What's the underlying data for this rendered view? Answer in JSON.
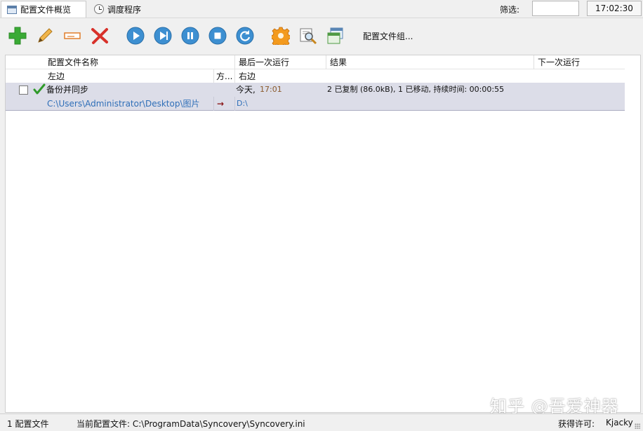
{
  "tabs": [
    {
      "label": "配置文件概览",
      "icon": "document-icon",
      "active": true
    },
    {
      "label": "调度程序",
      "icon": "clock-icon",
      "active": false
    }
  ],
  "filter": {
    "label": "筛选:",
    "value": ""
  },
  "clock": "17:02:30",
  "toolbar": {
    "buttons": [
      {
        "name": "add-profile-button",
        "icon": "plus-icon"
      },
      {
        "name": "edit-profile-button",
        "icon": "pencil-icon"
      },
      {
        "name": "rename-profile-button",
        "icon": "rename-icon"
      },
      {
        "name": "delete-profile-button",
        "icon": "x-icon"
      },
      {
        "name": "run-button",
        "icon": "play-icon"
      },
      {
        "name": "run-attended-button",
        "icon": "play-next-icon"
      },
      {
        "name": "pause-button",
        "icon": "pause-icon"
      },
      {
        "name": "stop-button",
        "icon": "stop-icon"
      },
      {
        "name": "refresh-button",
        "icon": "refresh-icon"
      },
      {
        "name": "settings-button",
        "icon": "gear-icon"
      },
      {
        "name": "log-button",
        "icon": "search-log-icon"
      },
      {
        "name": "profile-groups-button",
        "icon": "window-icon"
      }
    ],
    "groups_label": "配置文件组..."
  },
  "grid": {
    "headers_row1": {
      "name": "配置文件名称",
      "last_run": "最后一次运行",
      "result": "结果",
      "next_run": "下一次运行"
    },
    "headers_row2": {
      "left": "左边",
      "direction": "方...",
      "right": "右边"
    },
    "profiles": [
      {
        "name": "备份并同步",
        "last_run_day": "今天,",
        "last_run_time": "17:01",
        "result": "2 已复制 (86.0kB), 1 已移动, 持续时间: 00:00:55",
        "next_run": "",
        "left_path": "C:\\Users\\Administrator\\Desktop\\图片",
        "direction": "→",
        "right_path": "D:\\"
      }
    ]
  },
  "status": {
    "count": "1 配置文件",
    "current_label": "当前配置文件: C:\\ProgramData\\Syncovery\\Syncovery.ini",
    "license_label": "获得许可:",
    "license_user": "Kjacky"
  },
  "watermark": "知乎 @吾爱神器",
  "colors": {
    "selected_row": "#dcdde8",
    "path_text": "#2f6fb8",
    "accent_blue": "#3d8fd1",
    "plus_green": "#3aaa35",
    "delete_red": "#d8312a"
  }
}
